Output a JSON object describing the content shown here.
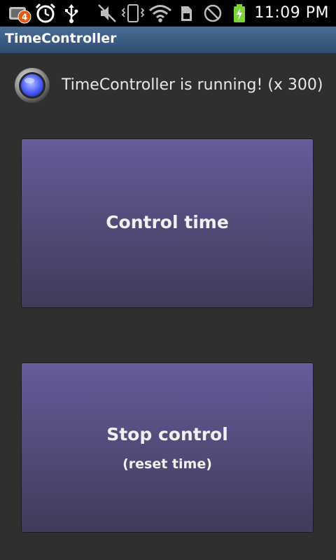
{
  "status_bar": {
    "time": "11:09 PM",
    "notification_count": "4",
    "icons": [
      "app-notification-icon",
      "alarm-clock-icon",
      "usb-icon",
      "vibrate-mode-icon",
      "wifi-icon",
      "sd-card-icon",
      "no-signal-icon",
      "battery-charging-icon"
    ]
  },
  "app": {
    "title": "TimeController"
  },
  "status": {
    "message": "TimeController is running! (x 300)",
    "indicator_color": "#5b6cff"
  },
  "buttons": {
    "control_time": "Control time",
    "stop_control": "Stop control",
    "stop_control_sub": "(reset time)"
  },
  "colors": {
    "background": "#2f2f2f",
    "title_bar": "#3f5f85",
    "button_top": "#655c9a",
    "button_bottom": "#3f3b59"
  }
}
